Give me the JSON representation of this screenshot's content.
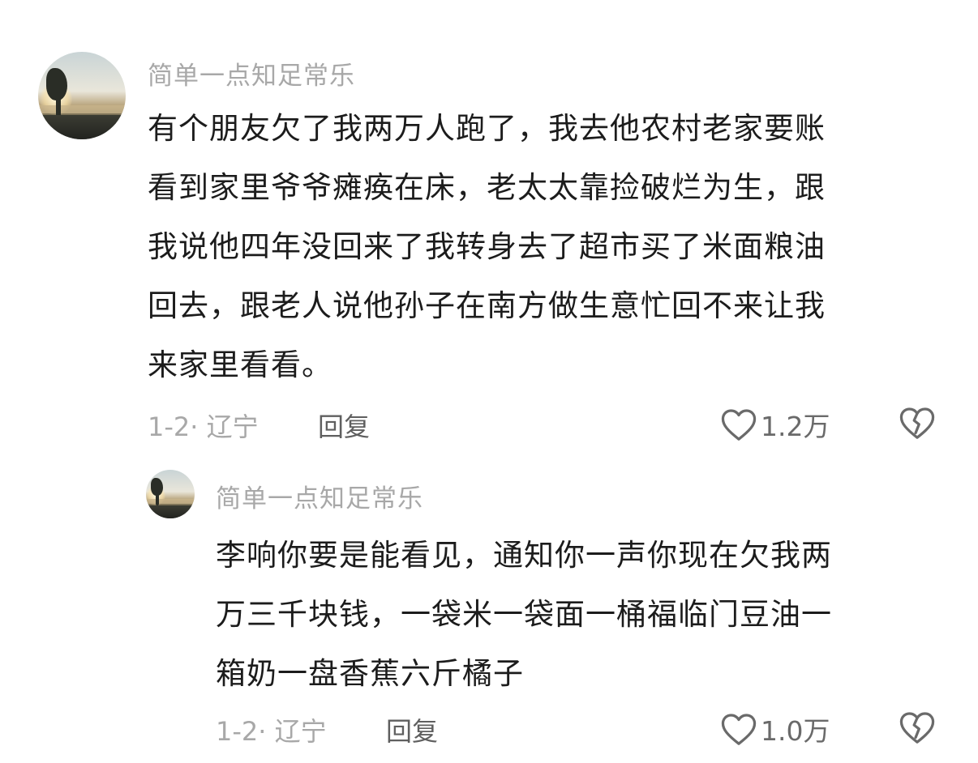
{
  "comments": [
    {
      "username": "简单一点知足常乐",
      "lines": [
        "有个朋友欠了我两万人跑了，我去他农村老家要账",
        "看到家里爷爷瘫痪在床，老太太靠捡破烂为生，跟",
        "我说他四年没回来了我转身去了超市买了米面粮油",
        "回去，跟老人说他孙子在南方做生意忙回不来让我",
        "来家里看看。"
      ],
      "date_location": "1-2· 辽宁",
      "reply_label": "回复",
      "like_count": "1.2万",
      "like_icon": "heart-outline-icon",
      "dislike_icon": "broken-heart-icon"
    },
    {
      "username": "简单一点知足常乐",
      "lines": [
        "李响你要是能看见，通知你一声你现在欠我两",
        "万三千块钱，一袋米一袋面一桶福临门豆油一",
        "箱奶一盘香蕉六斤橘子"
      ],
      "date_location": "1-2· 辽宁",
      "reply_label": "回复",
      "like_count": "1.0万",
      "like_icon": "heart-outline-icon",
      "dislike_icon": "broken-heart-icon"
    }
  ],
  "colors": {
    "text_primary": "#1c1c1c",
    "text_secondary": "#a8a8a8",
    "reply_text": "#5f5f5f",
    "icon": "#6a6a6a"
  }
}
